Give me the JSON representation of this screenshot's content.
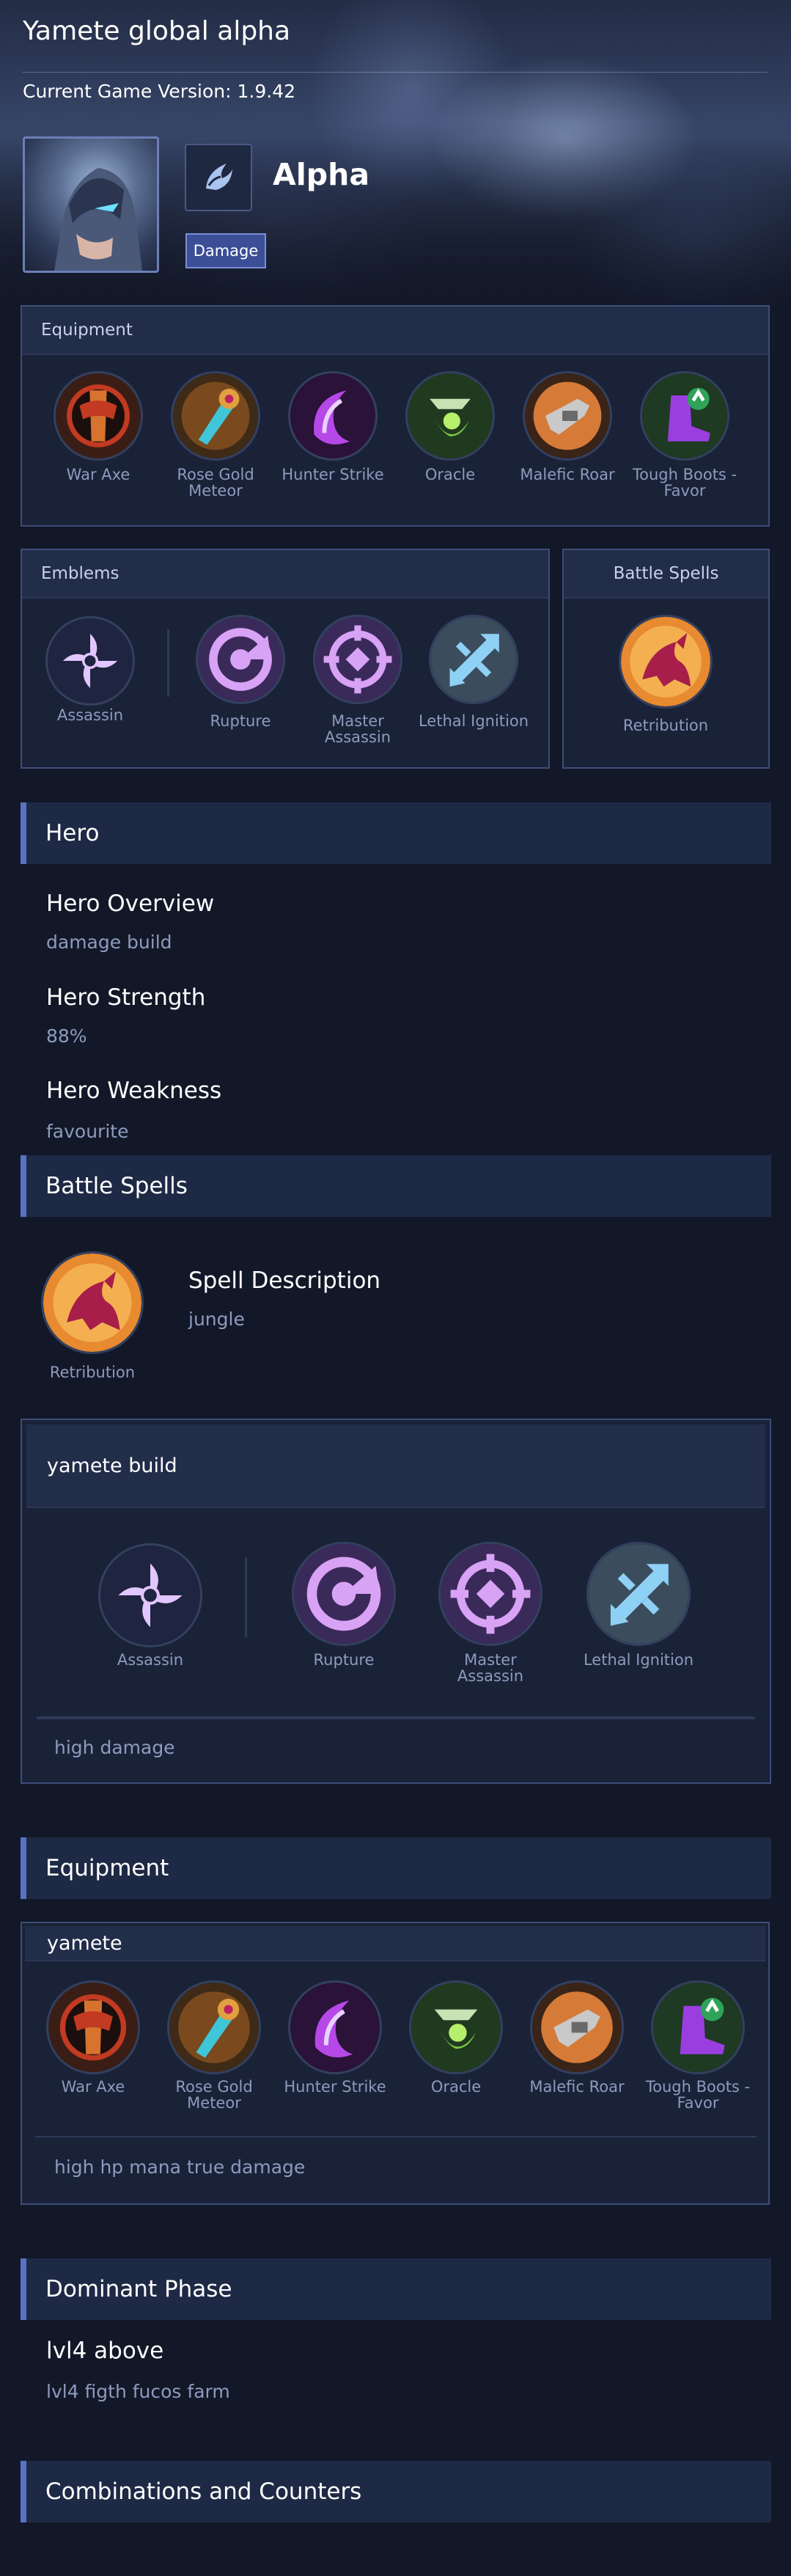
{
  "page": {
    "title": "Yamete global alpha",
    "version": "Current Game Version: 1.9.42"
  },
  "hero": {
    "name": "Alpha",
    "role_badge": "Damage",
    "role_icon": "fighter-claw-icon"
  },
  "equipment_panel": {
    "heading": "Equipment",
    "items": [
      {
        "label": "War Axe",
        "icon": "war-axe-icon",
        "colors": [
          "#c23a22",
          "#3a1e16"
        ]
      },
      {
        "label": "Rose Gold Meteor",
        "icon": "rose-gold-meteor-icon",
        "colors": [
          "#e0a040",
          "#3f2a18"
        ]
      },
      {
        "label": "Hunter Strike",
        "icon": "hunter-strike-icon",
        "colors": [
          "#b648e8",
          "#2a1238"
        ]
      },
      {
        "label": "Oracle",
        "icon": "oracle-icon",
        "colors": [
          "#7ccc42",
          "#203a20"
        ]
      },
      {
        "label": "Malefic Roar",
        "icon": "malefic-roar-icon",
        "colors": [
          "#d67a38",
          "#3a2418"
        ]
      },
      {
        "label": "Tough Boots - Favor",
        "icon": "tough-boots-favor-icon",
        "colors": [
          "#9a3ee0",
          "#1e3a22"
        ]
      }
    ]
  },
  "emblems_panel": {
    "heading": "Emblems",
    "main": {
      "label": "Assassin",
      "icon": "assassin-emblem-icon"
    },
    "talents": [
      {
        "label": "Rupture",
        "icon": "rupture-icon"
      },
      {
        "label": "Master Assassin",
        "icon": "master-assassin-icon"
      },
      {
        "label": "Lethal Ignition",
        "icon": "lethal-ignition-icon"
      }
    ]
  },
  "battle_spells_panel": {
    "heading": "Battle Spells",
    "spell": {
      "label": "Retribution",
      "icon": "retribution-icon"
    }
  },
  "hero_section": {
    "heading": "Hero",
    "overview_title": "Hero Overview",
    "overview": "damage build",
    "strength_title": "Hero Strength",
    "strength": "88%",
    "weakness_title": "Hero Weakness",
    "weakness": "favourite"
  },
  "battle_spells_section": {
    "heading": "Battle Spells",
    "spell_label": "Retribution",
    "desc_title": "Spell Description",
    "desc": "jungle"
  },
  "build_card": {
    "title": "yamete build",
    "main": {
      "label": "Assassin"
    },
    "talents": [
      {
        "label": "Rupture"
      },
      {
        "label": "Master Assassin"
      },
      {
        "label": "Lethal Ignition"
      }
    ],
    "note": "high damage"
  },
  "equipment_section": {
    "heading": "Equipment",
    "card_title": "yamete",
    "items": [
      "War Axe",
      "Rose Gold Meteor",
      "Hunter Strike",
      "Oracle",
      "Malefic Roar",
      "Tough Boots - Favor"
    ],
    "note": "high hp mana true damage"
  },
  "dominant_phase": {
    "heading": "Dominant Phase",
    "title": "lvl4 above",
    "text": "lvl4 figth fucos farm"
  },
  "combos": {
    "heading": "Combinations and Counters"
  },
  "colors": {
    "background": "#121828",
    "panel": "#1a2238",
    "accent": "#5a72c4",
    "muted_text": "#8d9bbd",
    "emblem_purple": "#c68ee8",
    "ignition_blue": "#6cb6e8"
  }
}
